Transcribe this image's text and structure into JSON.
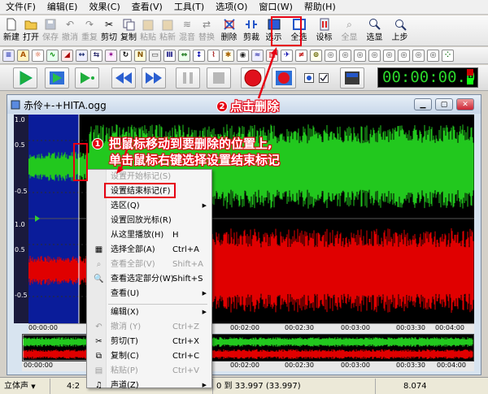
{
  "menu": [
    "文件(F)",
    "编辑(E)",
    "效果(C)",
    "查看(V)",
    "工具(T)",
    "选项(O)",
    "窗口(W)",
    "帮助(H)"
  ],
  "toolbar": {
    "buttons": [
      {
        "label": "新建",
        "icon": "new-file-icon",
        "enabled": true
      },
      {
        "label": "打开",
        "icon": "folder-open-icon",
        "enabled": true
      },
      {
        "label": "保存",
        "icon": "save-icon",
        "enabled": false
      },
      {
        "label": "撤消",
        "icon": "undo-icon",
        "enabled": false
      },
      {
        "label": "重复",
        "icon": "redo-icon",
        "enabled": false
      },
      {
        "label": "剪切",
        "icon": "scissors-icon",
        "enabled": true
      },
      {
        "label": "复制",
        "icon": "copy-icon",
        "enabled": true
      },
      {
        "label": "粘贴",
        "icon": "paste-icon",
        "enabled": false
      },
      {
        "label": "粘新",
        "icon": "paste-new-icon",
        "enabled": false
      },
      {
        "label": "混音",
        "icon": "mix-icon",
        "enabled": false
      },
      {
        "label": "替换",
        "icon": "replace-icon",
        "enabled": false
      },
      {
        "label": "删除",
        "icon": "delete-icon",
        "enabled": true
      },
      {
        "label": "剪裁",
        "icon": "trim-icon",
        "enabled": true
      },
      {
        "label": "选示",
        "icon": "select-view-icon",
        "enabled": true
      },
      {
        "label": "全选",
        "icon": "select-all-icon",
        "enabled": true
      },
      {
        "label": "设标",
        "icon": "set-marker-icon",
        "enabled": true
      },
      {
        "label": "全显",
        "icon": "show-all-icon",
        "enabled": false
      },
      {
        "label": "选显",
        "icon": "zoom-selection-icon",
        "enabled": true
      },
      {
        "label": "上步",
        "icon": "previous-step-icon",
        "enabled": true
      }
    ]
  },
  "timer": "00:00:00.0",
  "document": {
    "title": "赤伶+-+HITA.ogg"
  },
  "ruler_labels": [
    "1.0",
    "0.5",
    "-0.5",
    "1.0",
    "0.5",
    "-0.5"
  ],
  "time_ticks": [
    "00:00:00",
    "00:02:00",
    "00:02:30",
    "00:03:00",
    "00:03:30",
    "00:04:00"
  ],
  "overview_ticks": [
    "00:00:00",
    "00:02:00",
    "00:02:30",
    "00:03:00",
    "00:03:30",
    "00:04:00"
  ],
  "context_menu": {
    "items": [
      {
        "label": "设置开始标记(S)",
        "shortcut": "",
        "enabled": false,
        "submenu": false,
        "icon": ""
      },
      {
        "label": "设置结束标记(F)",
        "shortcut": "",
        "enabled": true,
        "submenu": false,
        "icon": ""
      },
      {
        "label": "选区(Q)",
        "shortcut": "",
        "enabled": true,
        "submenu": true,
        "icon": ""
      },
      {
        "label": "设置回放光标(R)",
        "shortcut": "",
        "enabled": true,
        "submenu": false,
        "icon": ""
      },
      {
        "label": "从这里播放(H)",
        "shortcut": "H",
        "enabled": true,
        "submenu": false,
        "icon": ""
      },
      {
        "label": "选择全部(A)",
        "shortcut": "Ctrl+A",
        "enabled": true,
        "submenu": false,
        "icon": "select-all-icon"
      },
      {
        "label": "查看全部(V)",
        "shortcut": "Shift+A",
        "enabled": false,
        "submenu": false,
        "icon": "view-all-icon"
      },
      {
        "label": "查看选定部分(W)",
        "shortcut": "Shift+S",
        "enabled": true,
        "submenu": false,
        "icon": "magnifier-icon"
      },
      {
        "label": "查看(U)",
        "shortcut": "",
        "enabled": true,
        "submenu": true,
        "icon": ""
      },
      {
        "label": "编辑(X)",
        "shortcut": "",
        "enabled": true,
        "submenu": true,
        "icon": ""
      },
      {
        "label": "撤消 (Y)",
        "shortcut": "Ctrl+Z",
        "enabled": false,
        "submenu": false,
        "icon": "undo-icon"
      },
      {
        "label": "剪切(T)",
        "shortcut": "Ctrl+X",
        "enabled": true,
        "submenu": false,
        "icon": "scissors-icon"
      },
      {
        "label": "复制(C)",
        "shortcut": "Ctrl+C",
        "enabled": true,
        "submenu": false,
        "icon": "copy-icon"
      },
      {
        "label": "粘贴(P)",
        "shortcut": "Ctrl+V",
        "enabled": false,
        "submenu": false,
        "icon": "paste-icon"
      },
      {
        "label": "声道(Z)",
        "shortcut": "",
        "enabled": true,
        "submenu": true,
        "icon": "channel-icon"
      }
    ]
  },
  "annotations": {
    "step1_badge": "1",
    "step1_line1": "把鼠标移动到要删除的位置上,",
    "step1_line2": "单击鼠标右键选择设置结束标记",
    "step2_badge": "2",
    "step2_text": "点击删除"
  },
  "statusbar": {
    "channel": "立体声",
    "position": "4:2",
    "selection": "0 到 33.997 (33.997)",
    "value": "8.074"
  },
  "colors": {
    "wave_top": "#22c81e",
    "wave_bottom": "#e00000",
    "selection": "#0a1c9a",
    "accent": "#e60012",
    "timer_text": "#2bd62b"
  }
}
